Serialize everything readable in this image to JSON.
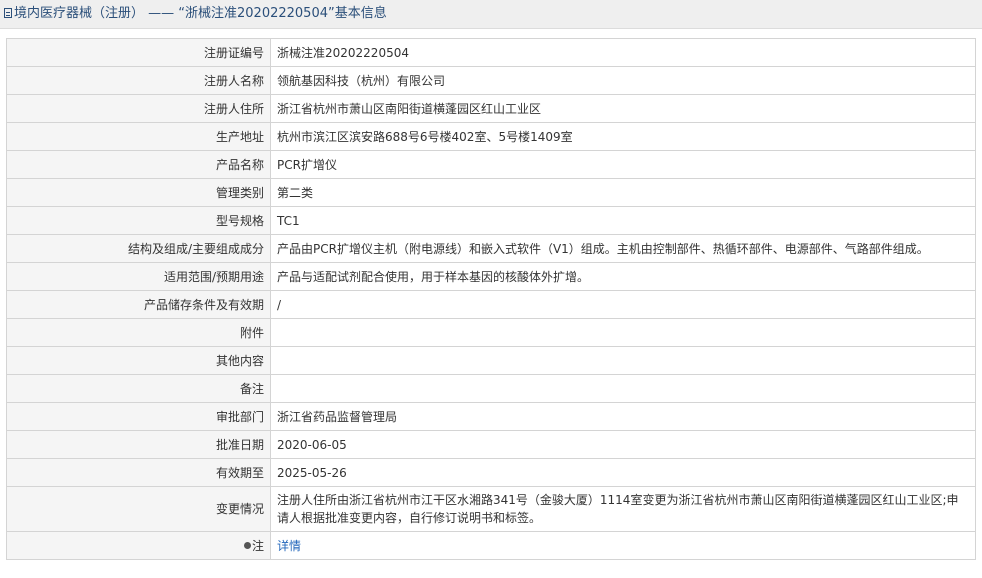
{
  "header": {
    "category": "境内医疗器械（注册）",
    "separator": " —— ",
    "record_title": "“浙械注准20202220504”基本信息"
  },
  "rows": [
    {
      "label": "注册证编号",
      "value": "浙械注准20202220504"
    },
    {
      "label": "注册人名称",
      "value": "领航基因科技（杭州）有限公司"
    },
    {
      "label": "注册人住所",
      "value": "浙江省杭州市萧山区南阳街道横蓬园区红山工业区"
    },
    {
      "label": "生产地址",
      "value": "杭州市滨江区滨安路688号6号楼402室、5号楼1409室"
    },
    {
      "label": "产品名称",
      "value": "PCR扩增仪"
    },
    {
      "label": "管理类别",
      "value": "第二类"
    },
    {
      "label": "型号规格",
      "value": "TC1"
    },
    {
      "label": "结构及组成/主要组成成分",
      "value": "产品由PCR扩增仪主机（附电源线）和嵌入式软件（V1）组成。主机由控制部件、热循环部件、电源部件、气路部件组成。"
    },
    {
      "label": "适用范围/预期用途",
      "value": "产品与适配试剂配合使用，用于样本基因的核酸体外扩增。"
    },
    {
      "label": "产品储存条件及有效期",
      "value": "/"
    },
    {
      "label": "附件",
      "value": ""
    },
    {
      "label": "其他内容",
      "value": ""
    },
    {
      "label": "备注",
      "value": ""
    },
    {
      "label": "审批部门",
      "value": "浙江省药品监督管理局"
    },
    {
      "label": "批准日期",
      "value": "2020-06-05"
    },
    {
      "label": "有效期至",
      "value": "2025-05-26"
    },
    {
      "label": "变更情况",
      "value": "注册人住所由浙江省杭州市江干区水湘路341号（金骏大厦）1114室变更为浙江省杭州市萧山区南阳街道横蓬园区红山工业区;申请人根据批准变更内容，自行修订说明书和标签。"
    }
  ],
  "note": {
    "label": "注",
    "icon": "pin-icon",
    "link_text": "详情"
  }
}
